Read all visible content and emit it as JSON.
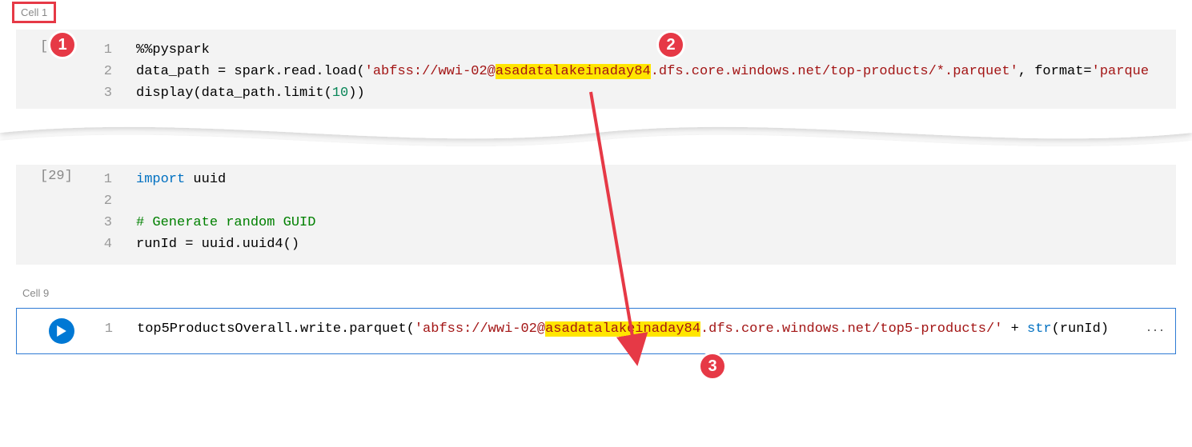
{
  "labels": {
    "cell1": "Cell 1",
    "cell9": "Cell 9"
  },
  "cell1": {
    "exec": "[22]",
    "ln1": "1",
    "ln2": "2",
    "ln3": "3",
    "line1": "%%pyspark",
    "l2_a": "data_path = spark.read.load(",
    "l2_s1": "'abfss://wwi-02@",
    "l2_hl": "asadatalakeinaday84",
    "l2_s2": ".dfs.core.windows.net/top-products/*.parquet'",
    "l2_b": ", format=",
    "l2_s3": "'parque",
    "l3_a": "display(data_path.limit(",
    "l3_n": "10",
    "l3_b": "))"
  },
  "cell2": {
    "exec": "[29]",
    "ln1": "1",
    "ln2": "2",
    "ln3": "3",
    "ln4": "4",
    "l1_k": "import",
    "l1_b": " uuid",
    "l3_c": "# Generate random GUID",
    "l4": "runId = uuid.uuid4()"
  },
  "cell9": {
    "ln1": "1",
    "l_a": "top5ProductsOverall.write.parquet(",
    "l_s1": "'abfss://wwi-02@",
    "l_hl": "asadatalakeinaday84",
    "l_s2": ".dfs.core.windows.net/top5-products/'",
    "l_b": " + ",
    "l_k": "str",
    "l_c": "(runId) "
  },
  "badges": {
    "b1": "1",
    "b2": "2",
    "b3": "3"
  }
}
